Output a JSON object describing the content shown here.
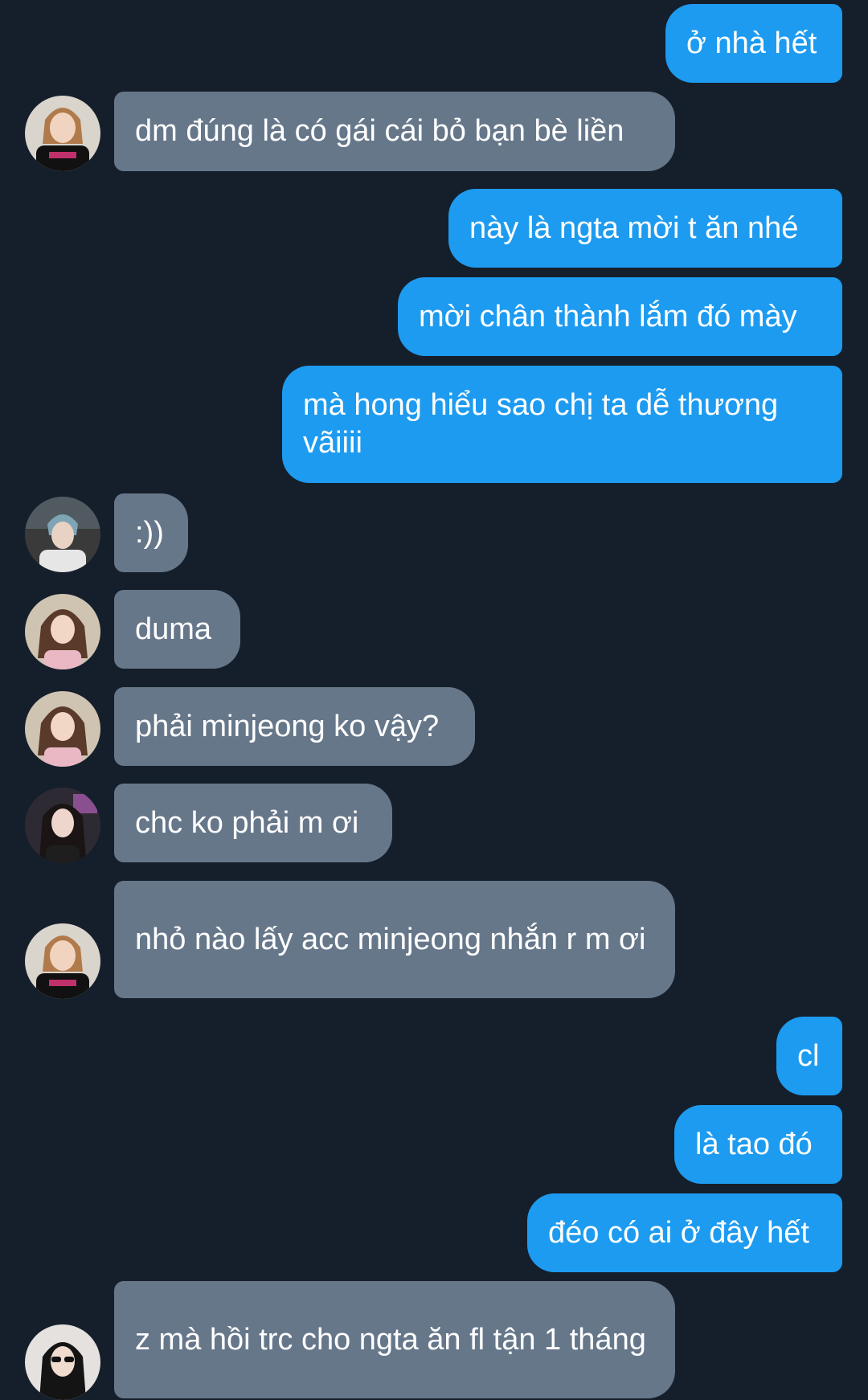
{
  "conversation": {
    "messages": [
      {
        "dir": "out",
        "text": "ở nhà hết"
      },
      {
        "dir": "in",
        "avatar": "avatar-a",
        "text": "dm đúng là có gái cái bỏ bạn bè liền"
      },
      {
        "dir": "out",
        "text": "này là ngta mời t ăn nhé"
      },
      {
        "dir": "out",
        "text": "mời chân thành lắm đó mày"
      },
      {
        "dir": "out",
        "text": "mà hong hiểu sao chị ta dễ thương vãiiii"
      },
      {
        "dir": "in",
        "avatar": "avatar-b",
        "text": ":))"
      },
      {
        "dir": "in",
        "avatar": "avatar-c",
        "text": "duma"
      },
      {
        "dir": "in",
        "avatar": "avatar-c",
        "text": "phải minjeong ko vậy?"
      },
      {
        "dir": "in",
        "avatar": "avatar-d",
        "text": "chc ko phải m ơi"
      },
      {
        "dir": "in",
        "avatar": "avatar-a",
        "text": "nhỏ nào lấy acc minjeong nhắn r m ơi"
      },
      {
        "dir": "out",
        "text": "cl"
      },
      {
        "dir": "out",
        "text": "là tao đó"
      },
      {
        "dir": "out",
        "text": "đéo có ai ở đây hết"
      },
      {
        "dir": "in",
        "avatar": "avatar-e",
        "text": "z mà hồi trc cho ngta ăn fl tận 1 tháng"
      }
    ]
  },
  "colors": {
    "background": "#151f2b",
    "outgoing_bubble": "#1d9bf0",
    "incoming_bubble": "#66778a",
    "text": "#ffffff"
  }
}
